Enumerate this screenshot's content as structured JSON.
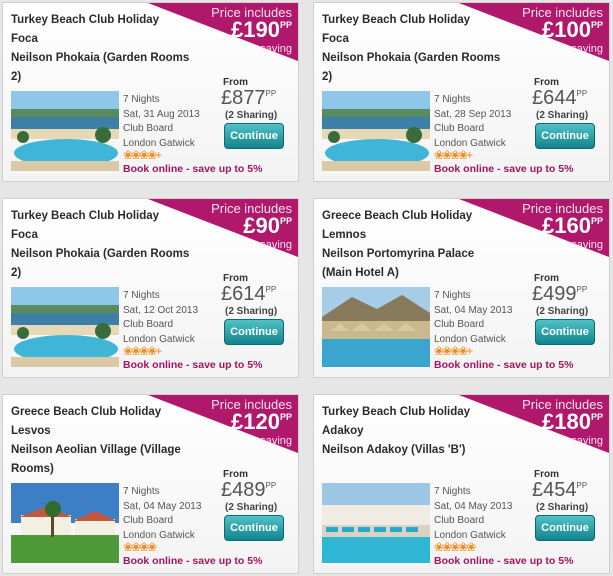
{
  "cards": [
    {
      "type": "Turkey Beach Club Holiday",
      "location": "Foca",
      "hotel": "Neilson Phokaia (Garden Rooms 2)",
      "price_includes": "Price includes",
      "saving_amount": "£190",
      "saving_pp": "PP",
      "saving_label": "saving",
      "nights": "7 Nights",
      "date": "Sat, 31 Aug 2013",
      "board": "Club Board",
      "airport": "London Gatwick",
      "from_label": "From",
      "price": "£877",
      "price_pp": "PP",
      "sharing": "(2 Sharing)",
      "continue_label": "Continue",
      "rating": "❀❀❀❀+",
      "book_online": "Book online - save up to 5%",
      "image": "beach-pool"
    },
    {
      "type": "Turkey Beach Club Holiday",
      "location": "Foca",
      "hotel": "Neilson Phokaia (Garden Rooms 2)",
      "price_includes": "Price includes",
      "saving_amount": "£100",
      "saving_pp": "PP",
      "saving_label": "saving",
      "nights": "7 Nights",
      "date": "Sat, 28 Sep 2013",
      "board": "Club Board",
      "airport": "London Gatwick",
      "from_label": "From",
      "price": "£644",
      "price_pp": "PP",
      "sharing": "(2 Sharing)",
      "continue_label": "Continue",
      "rating": "❀❀❀❀+",
      "book_online": "Book online - save up to 5%",
      "image": "beach-pool"
    },
    {
      "type": "Turkey Beach Club Holiday",
      "location": "Foca",
      "hotel": "Neilson Phokaia (Garden Rooms 2)",
      "price_includes": "Price includes",
      "saving_amount": "£90",
      "saving_pp": "PP",
      "saving_label": "saving",
      "nights": "7 Nights",
      "date": "Sat, 12 Oct 2013",
      "board": "Club Board",
      "airport": "London Gatwick",
      "from_label": "From",
      "price": "£614",
      "price_pp": "PP",
      "sharing": "(2 Sharing)",
      "continue_label": "Continue",
      "rating": "❀❀❀❀+",
      "book_online": "Book online - save up to 5%",
      "image": "beach-pool"
    },
    {
      "type": "Greece Beach Club Holiday",
      "location": "Lemnos",
      "hotel": "Neilson Portomyrina Palace (Main Hotel A)",
      "price_includes": "Price includes",
      "saving_amount": "£160",
      "saving_pp": "PP",
      "saving_label": "saving",
      "nights": "7 Nights",
      "date": "Sat, 04 May 2013",
      "board": "Club Board",
      "airport": "London Gatwick",
      "from_label": "From",
      "price": "£499",
      "price_pp": "PP",
      "sharing": "(2 Sharing)",
      "continue_label": "Continue",
      "rating": "❀❀❀❀+",
      "book_online": "Book online - save up to 5%",
      "image": "beach-umbrellas"
    },
    {
      "type": "Greece Beach Club Holiday",
      "location": "Lesvos",
      "hotel": "Neilson Aeolian Village (Village Rooms)",
      "price_includes": "Price includes",
      "saving_amount": "£120",
      "saving_pp": "PP",
      "saving_label": "saving",
      "nights": "7 Nights",
      "date": "Sat, 04 May 2013",
      "board": "Club Board",
      "airport": "London Gatwick",
      "from_label": "From",
      "price": "£489",
      "price_pp": "PP",
      "sharing": "(2 Sharing)",
      "continue_label": "Continue",
      "rating": "❀❀❀❀",
      "book_online": "Book online - save up to 5%",
      "image": "village-lawn"
    },
    {
      "type": "Turkey Beach Club Holiday",
      "location": "Adakoy",
      "hotel": "Neilson Adakoy (Villas 'B')",
      "price_includes": "Price includes",
      "saving_amount": "£180",
      "saving_pp": "PP",
      "saving_label": "saving",
      "nights": "7 Nights",
      "date": "Sat, 04 May 2013",
      "board": "Club Board",
      "airport": "London Gatwick",
      "from_label": "From",
      "price": "£454",
      "price_pp": "PP",
      "sharing": "(2 Sharing)",
      "continue_label": "Continue",
      "rating": "❀❀❀❀❀",
      "book_online": "Book online - save up to 5%",
      "image": "pool-loungers"
    }
  ]
}
